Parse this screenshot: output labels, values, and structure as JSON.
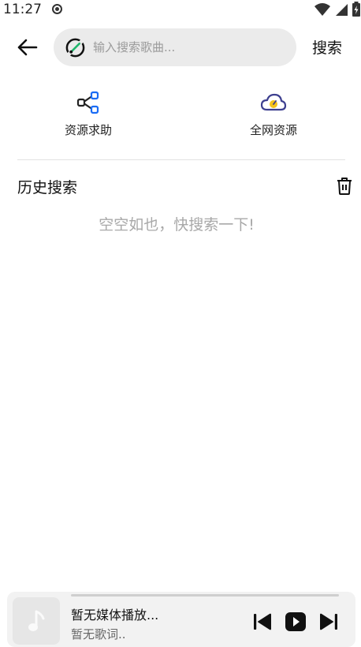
{
  "status_bar": {
    "time": "11:27",
    "icons": [
      "record-dot-icon",
      "wifi-icon",
      "cell-signal-icon",
      "battery-charging-icon"
    ]
  },
  "top_bar": {
    "back_icon": "arrow-left-icon",
    "search_logo_icon": "app-logo-icon",
    "search_placeholder": "输入搜索歌曲...",
    "search_value": "",
    "search_button_label": "搜索"
  },
  "quick_actions": [
    {
      "label": "资源求助",
      "icon": "share-nodes-icon",
      "icon_color": "#1a6cf5"
    },
    {
      "label": "全网资源",
      "icon": "cloud-gauge-icon",
      "icon_color": "#3d3f8f",
      "accent": "#f5c21b"
    }
  ],
  "history": {
    "title": "历史搜索",
    "clear_icon": "trash-icon",
    "empty_text": "空空如也，快搜索一下!"
  },
  "player": {
    "cover_icon": "music-note-icon",
    "title": "暂无媒体播放...",
    "lyric": "暂无歌词..",
    "controls": [
      "skip-previous-icon",
      "play-icon",
      "skip-next-icon"
    ],
    "progress": 0
  },
  "colors": {
    "search_bg": "#ebebeb",
    "player_bg": "#f2f2f2",
    "logo_green": "#1fb56b",
    "text_muted": "#a8a8a8"
  }
}
